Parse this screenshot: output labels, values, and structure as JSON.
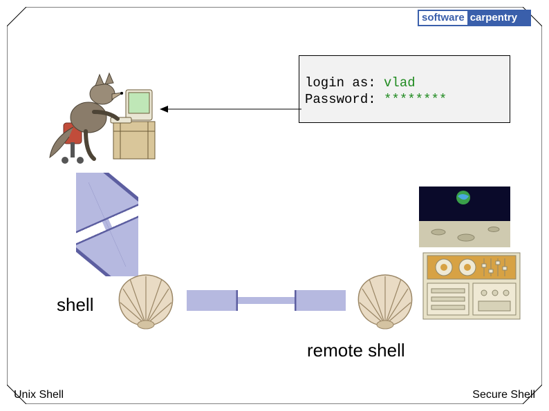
{
  "logo": {
    "word1": "software",
    "word2": "carpentry"
  },
  "terminal": {
    "line1_prompt": "login as: ",
    "line1_value": "vlad",
    "line2_prompt": "Password: ",
    "line2_value": "********"
  },
  "labels": {
    "shell": "shell",
    "remote_shell": "remote shell"
  },
  "footer": {
    "left": "Unix Shell",
    "right": "Secure Shell"
  },
  "icons": {
    "wolf": "wolf-at-computer-illustration",
    "shell": "scallop-shell-icon",
    "server": "server-under-moon-illustration",
    "arrow_single": "left-arrow",
    "arrow_double": "double-headed-arrow"
  },
  "colors": {
    "accent": "#3a5fab",
    "input_green": "#1f8a1f",
    "arrow_lavender": "#b6b9e0",
    "shell_cream": "#e9dbc4",
    "shell_stroke": "#9b8766"
  }
}
